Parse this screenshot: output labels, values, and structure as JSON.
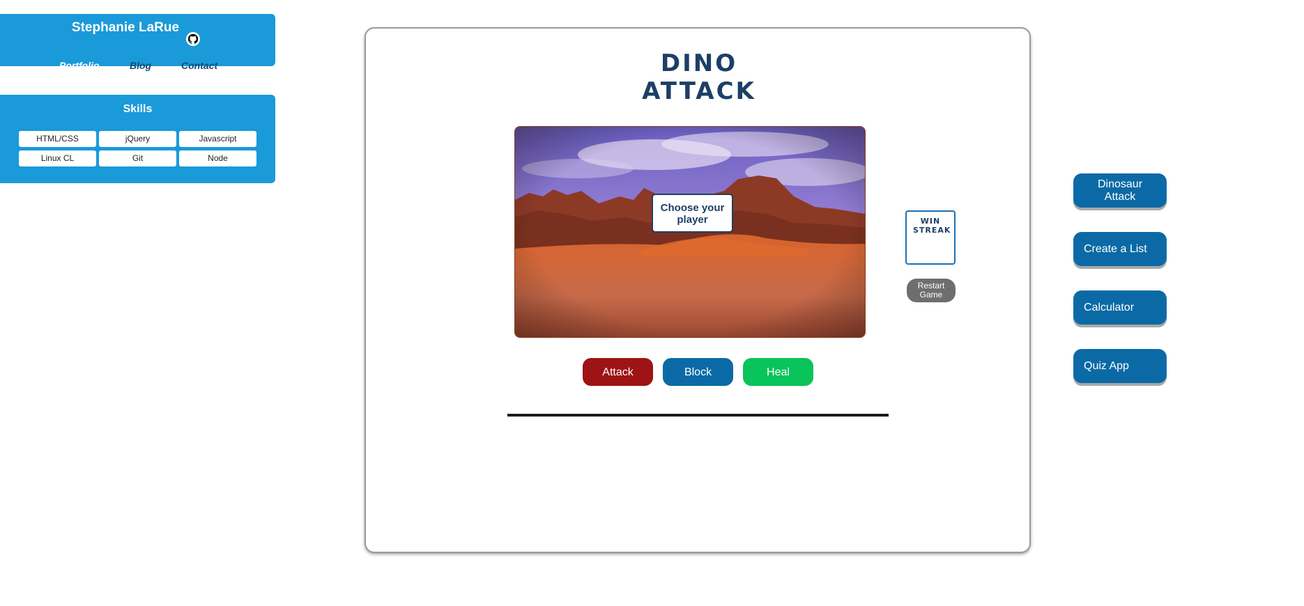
{
  "header": {
    "name": "Stephanie LaRue",
    "nav": [
      "Portfolio",
      "Blog",
      "Contact"
    ]
  },
  "skills": {
    "title": "Skills",
    "items": [
      "HTML/CSS",
      "jQuery",
      "Javascript",
      "Linux CL",
      "Git",
      "Node"
    ]
  },
  "game": {
    "title": "DINO ATTACK",
    "prompt": "Choose your player",
    "actions": [
      "Attack",
      "Block",
      "Heal"
    ],
    "win_streak": "WIN STREAK",
    "restart": "Restart Game"
  },
  "projects": [
    "Dinosaur Attack",
    "Create a List",
    "Calculator",
    "Quiz App"
  ],
  "colors": {
    "brand_blue": "#1a9ad9",
    "button_blue": "#0b6aa6",
    "attack_red": "#9e1414",
    "heal_green": "#08c45a",
    "title_navy": "#1d3f66"
  }
}
